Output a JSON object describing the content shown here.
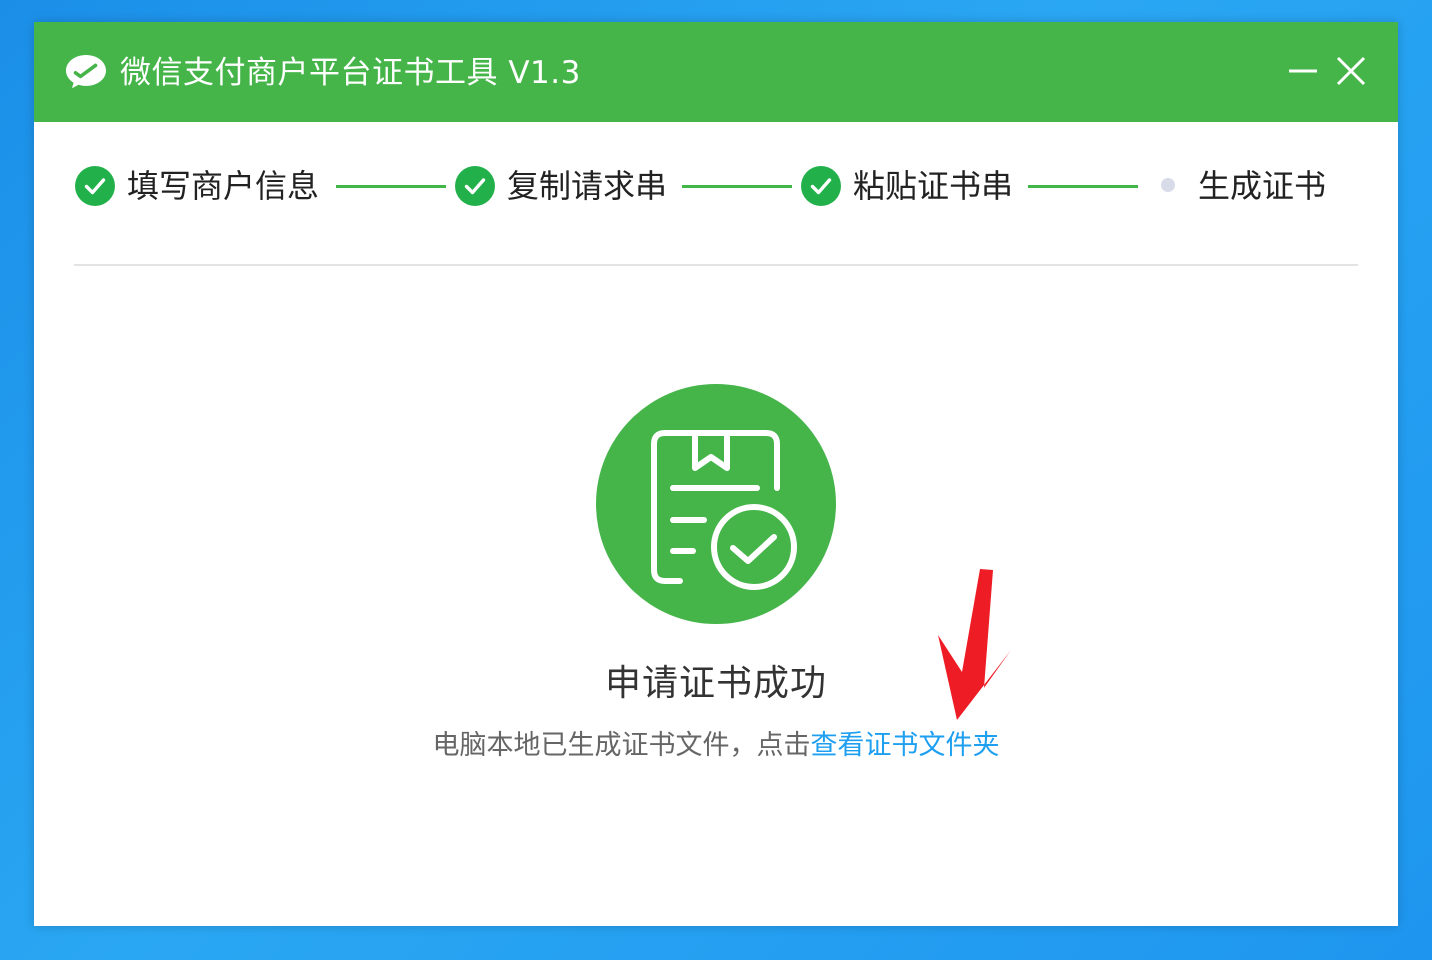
{
  "window": {
    "title": "微信支付商户平台证书工具 V1.3",
    "accent_color": "#45b54a",
    "controls": [
      "minimize-icon",
      "close-icon"
    ]
  },
  "steps": [
    {
      "label": "填写商户信息",
      "status": "done"
    },
    {
      "label": "复制请求串",
      "status": "done"
    },
    {
      "label": "粘贴证书串",
      "status": "done"
    },
    {
      "label": "生成证书",
      "status": "current"
    }
  ],
  "result": {
    "icon": "certificate-success-icon",
    "title": "申请证书成功",
    "description": "电脑本地已生成证书文件，点击",
    "link_text": "查看证书文件夹",
    "link_color": "#1e9ff0"
  },
  "annotation": {
    "icon": "red-arrow-icon",
    "color": "#ee1c25"
  }
}
